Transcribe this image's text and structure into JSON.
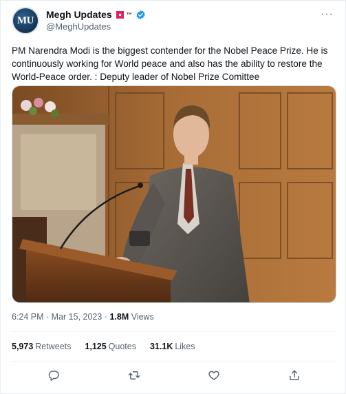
{
  "tweet": {
    "display_name": "Megh Updates",
    "tm": "™",
    "handle": "@MeghUpdates",
    "avatar_text": "MU",
    "text": "PM Narendra Modi is the biggest contender for the Nobel Peace Prize. He is continuously working for World peace and also has the ability to restore the World-Peace order. : Deputy leader of Nobel Prize Comittee",
    "time": "6:24 PM · Mar 15, 2023 · ",
    "views_count": "1.8M",
    "views_label": " Views"
  },
  "stats": {
    "retweets_count": "5,973",
    "retweets_label": "Retweets",
    "quotes_count": "1,125",
    "quotes_label": "Quotes",
    "likes_count": "31.1K",
    "likes_label": "Likes"
  },
  "icons": {
    "more": "more-icon",
    "verified": "verified-badge-icon",
    "reply": "reply-icon",
    "retweet": "retweet-icon",
    "like": "like-icon",
    "share": "share-icon"
  },
  "colors": {
    "verified_blue": "#1d9bf0",
    "secondary_text": "#536471",
    "primary_text": "#0f1419"
  }
}
